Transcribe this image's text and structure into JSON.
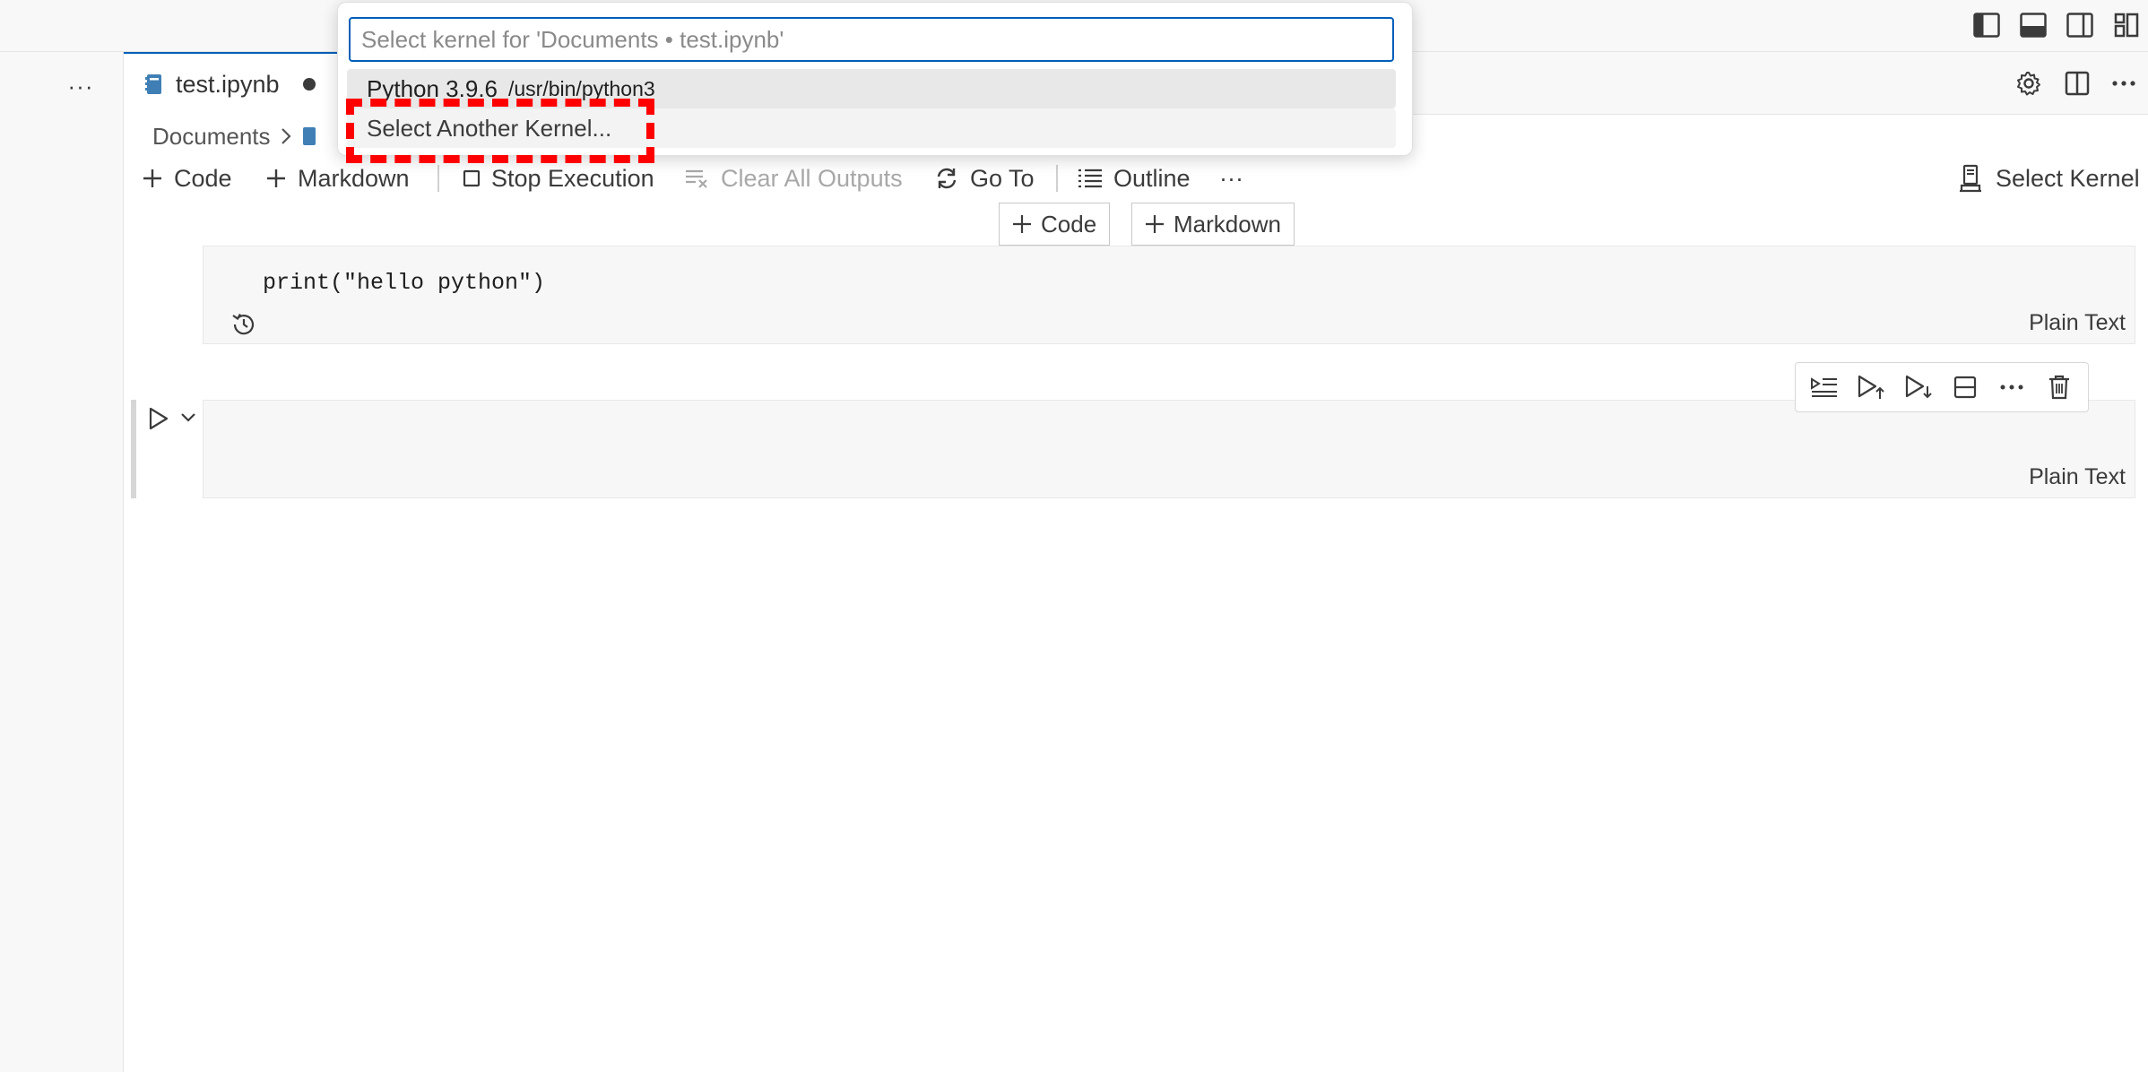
{
  "tab": {
    "label": "test.ipynb"
  },
  "breadcrumb": {
    "folder": "Documents"
  },
  "toolbar": {
    "code": "Code",
    "markdown": "Markdown",
    "stop_execution": "Stop Execution",
    "clear_all_outputs": "Clear All Outputs",
    "go_to": "Go To",
    "outline": "Outline",
    "more": "···",
    "select_kernel": "Select Kernel"
  },
  "insert": {
    "code": "Code",
    "markdown": "Markdown"
  },
  "cells": [
    {
      "code": "print(\"hello python\")",
      "language": "Plain Text"
    },
    {
      "code": "",
      "language": "Plain Text"
    }
  ],
  "quickpick": {
    "placeholder": "Select kernel for 'Documents • test.ipynb'",
    "items": [
      {
        "label": "Python 3.9.6",
        "description": "/usr/bin/python3"
      },
      {
        "label": "Select Another Kernel..."
      }
    ]
  },
  "left": {
    "more": "···"
  },
  "accent": "#005fb8",
  "highlight_color": "#ff0000"
}
